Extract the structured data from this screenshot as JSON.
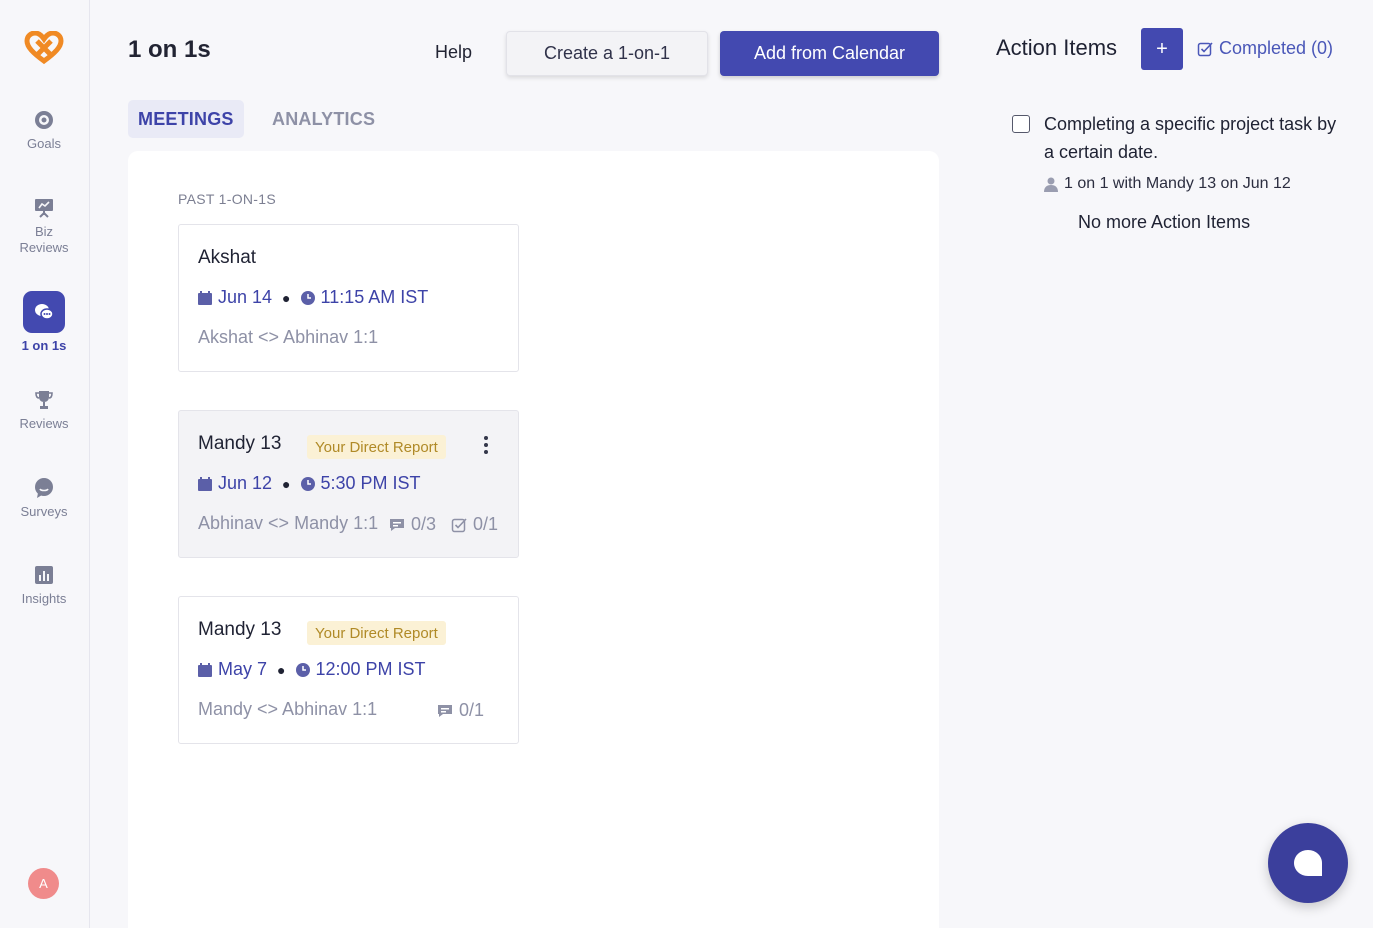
{
  "sidebar": {
    "items": [
      {
        "label": "Goals",
        "icon": "target-icon"
      },
      {
        "label": "Biz\nReviews",
        "icon": "presentation-icon"
      },
      {
        "label": "1 on 1s",
        "icon": "chat-bubbles-icon",
        "active": true
      },
      {
        "label": "Reviews",
        "icon": "trophy-icon"
      },
      {
        "label": "Surveys",
        "icon": "survey-bubble-icon"
      },
      {
        "label": "Insights",
        "icon": "bar-chart-icon"
      }
    ],
    "avatar_initial": "A"
  },
  "header": {
    "title": "1 on 1s",
    "help_label": "Help",
    "create_label": "Create a 1-on-1",
    "calendar_label": "Add from Calendar"
  },
  "tabs": [
    {
      "label": "MEETINGS",
      "active": true
    },
    {
      "label": "ANALYTICS",
      "active": false
    }
  ],
  "meetings": {
    "section_label": "PAST 1-ON-1S",
    "cards": [
      {
        "name": "Akshat",
        "badge": "",
        "date": "Jun 14",
        "time": "11:15 AM IST",
        "description": "Akshat <> Abhinav 1:1",
        "talking_points": "",
        "action_items": ""
      },
      {
        "name": "Mandy 13",
        "badge": "Your Direct Report",
        "date": "Jun 12",
        "time": "5:30 PM IST",
        "description": "Abhinav <> Mandy 1:1",
        "talking_points": "0/3",
        "action_items": "0/1"
      },
      {
        "name": "Mandy 13",
        "badge": "Your Direct Report",
        "date": "May 7",
        "time": "12:00 PM IST",
        "description": "Mandy <> Abhinav 1:1",
        "talking_points": "0/1",
        "action_items": ""
      }
    ]
  },
  "action_items": {
    "title": "Action Items",
    "add_label": "+",
    "completed_label": "Completed (0)",
    "items": [
      {
        "text": "Completing a specific project task by a certain date.",
        "meta": "1 on 1 with Mandy 13 on Jun 12"
      }
    ],
    "empty_label": "No more Action Items"
  },
  "colors": {
    "accent": "#4349b0",
    "badge_bg": "#fbf1d5",
    "badge_text": "#b08a27",
    "logo": "#f08a24"
  }
}
